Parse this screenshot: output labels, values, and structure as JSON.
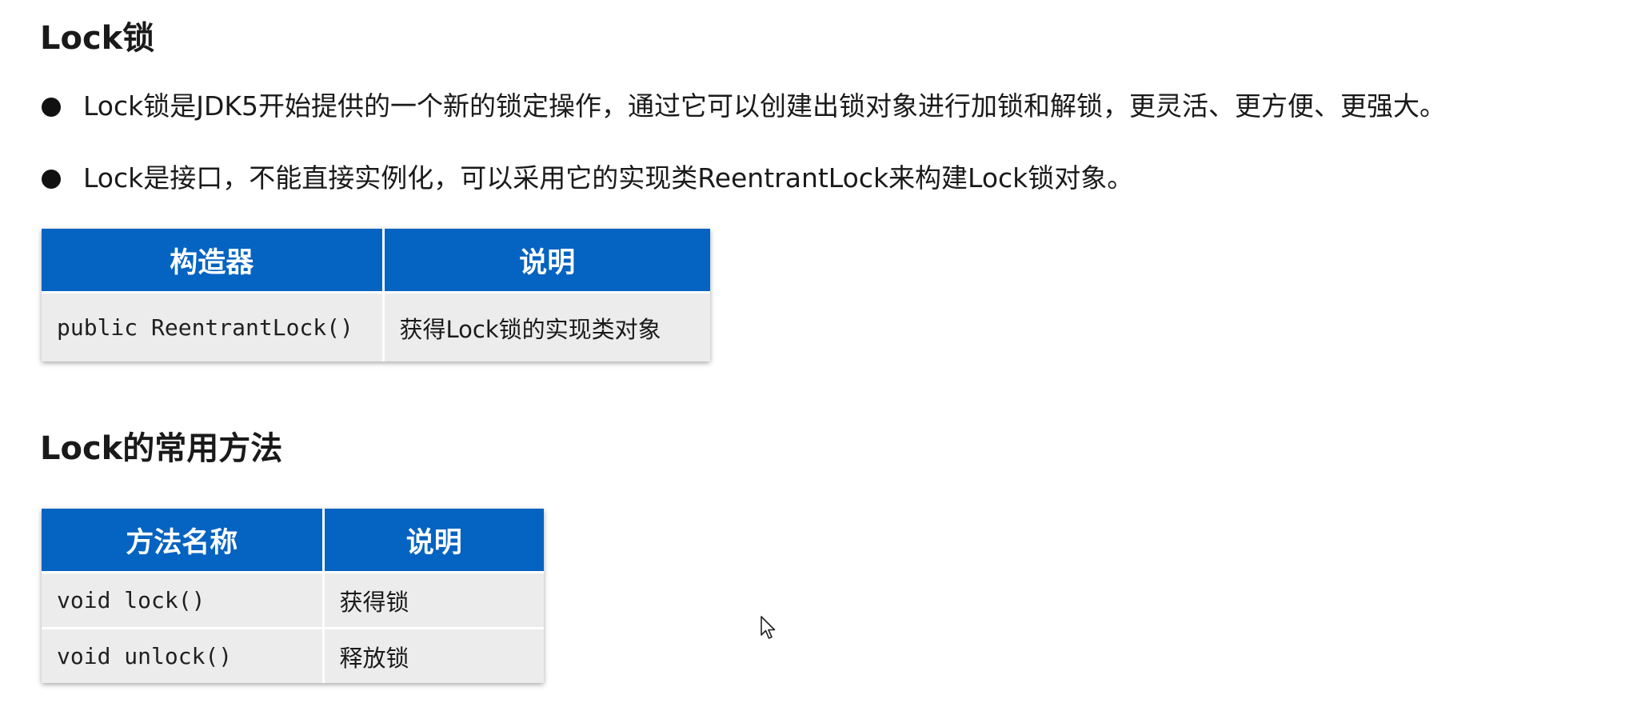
{
  "section1": {
    "title": "Lock锁",
    "bullets": [
      "Lock锁是JDK5开始提供的一个新的锁定操作，通过它可以创建出锁对象进行加锁和解锁，更灵活、更方便、更强大。",
      "Lock是接口，不能直接实例化，可以采用它的实现类ReentrantLock来构建Lock锁对象。"
    ],
    "constructor_table": {
      "headers": [
        "构造器",
        "说明"
      ],
      "rows": [
        [
          "public ReentrantLock()",
          "获得Lock锁的实现类对象"
        ]
      ]
    }
  },
  "section2": {
    "title": "Lock的常用方法",
    "methods_table": {
      "headers": [
        "方法名称",
        "说明"
      ],
      "rows": [
        [
          "void lock()",
          "获得锁"
        ],
        [
          "void unlock()",
          "释放锁"
        ]
      ]
    }
  },
  "colors": {
    "header_bg": "#0563c1",
    "cell_bg": "#ececec",
    "text": "#1a1a1a"
  },
  "icons": {
    "cursor": "mouse-pointer-icon",
    "bullet": "bullet-dot-icon"
  }
}
